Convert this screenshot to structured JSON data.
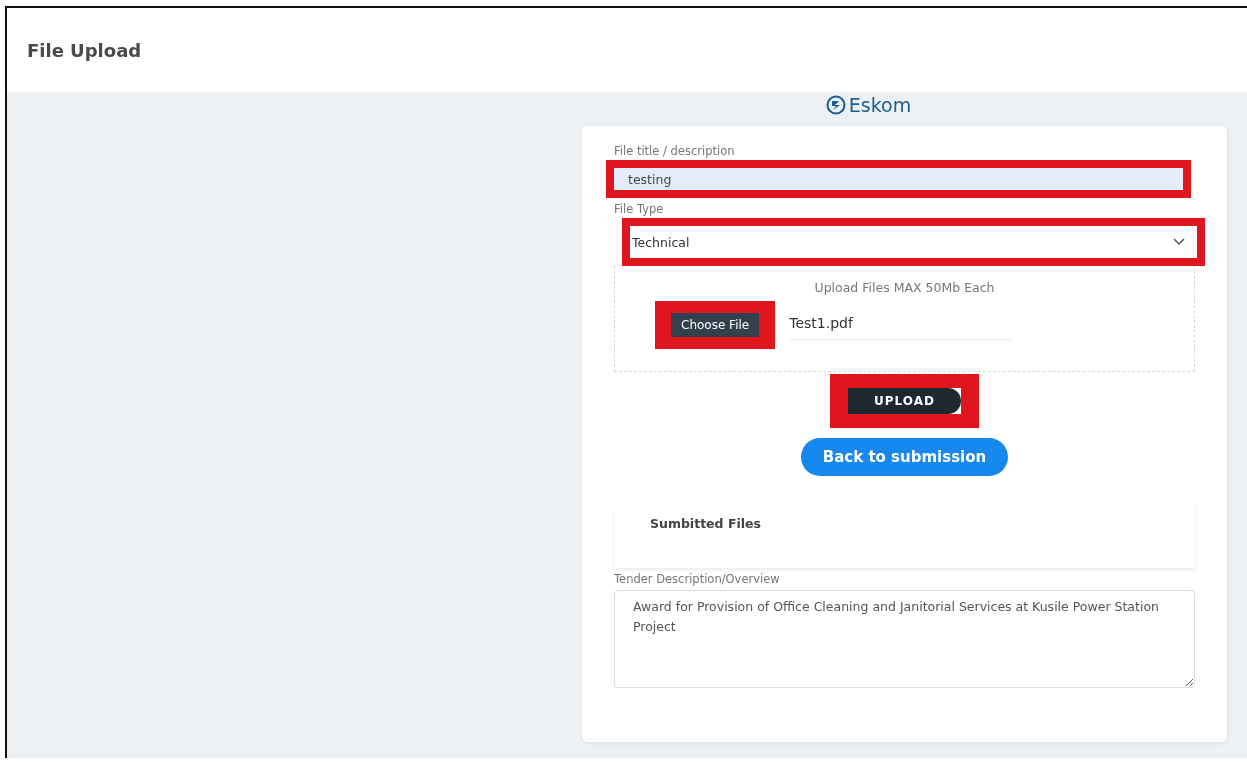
{
  "header": {
    "title": "File Upload"
  },
  "logo": {
    "text": "Eskom"
  },
  "form": {
    "title_field": {
      "label": "File title / description",
      "value": "testing",
      "highlighted": true
    },
    "file_type": {
      "label": "File Type",
      "value": "Technical",
      "highlighted": true
    },
    "upload_zone": {
      "hint": "Upload Files MAX 50Mb Each",
      "choose_button": "Choose File",
      "choose_highlighted": true,
      "file_name": "Test1.pdf"
    },
    "upload_button": {
      "label": "UPLOAD",
      "highlighted": true
    },
    "back_button": {
      "label": "Back to submission"
    },
    "submitted_files": {
      "title": "Sumbitted Files"
    },
    "tender": {
      "label": "Tender Description/Overview",
      "value": "Award for Provision of Office Cleaning and Janitorial Services at Kusile Power Station Project"
    }
  }
}
